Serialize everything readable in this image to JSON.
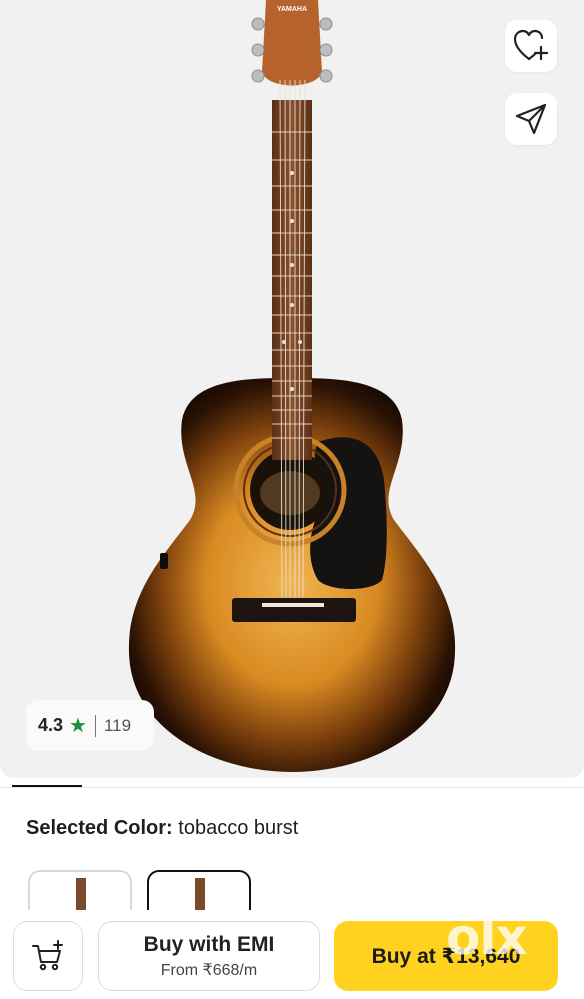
{
  "product": {
    "headstock_brand": "YAMAHA",
    "rating": {
      "score": "4.3",
      "count": "119"
    }
  },
  "actions": {
    "wishlist_icon": "heart-plus-icon",
    "share_icon": "send-icon"
  },
  "variant": {
    "selected_label": "Selected Color:",
    "selected_value": "tobacco burst",
    "swatches_visible": 2,
    "selected_index": 1
  },
  "bottom_bar": {
    "cart_icon": "cart-plus-icon",
    "emi_title": "Buy with EMI",
    "emi_subtitle": "From ₹668/m",
    "buy_label": "Buy at ₹13,640"
  },
  "watermark": "olx",
  "colors": {
    "buy_button": "#ffd21f",
    "star": "#1e8e3e",
    "hero_bg": "#f1f1f1"
  }
}
